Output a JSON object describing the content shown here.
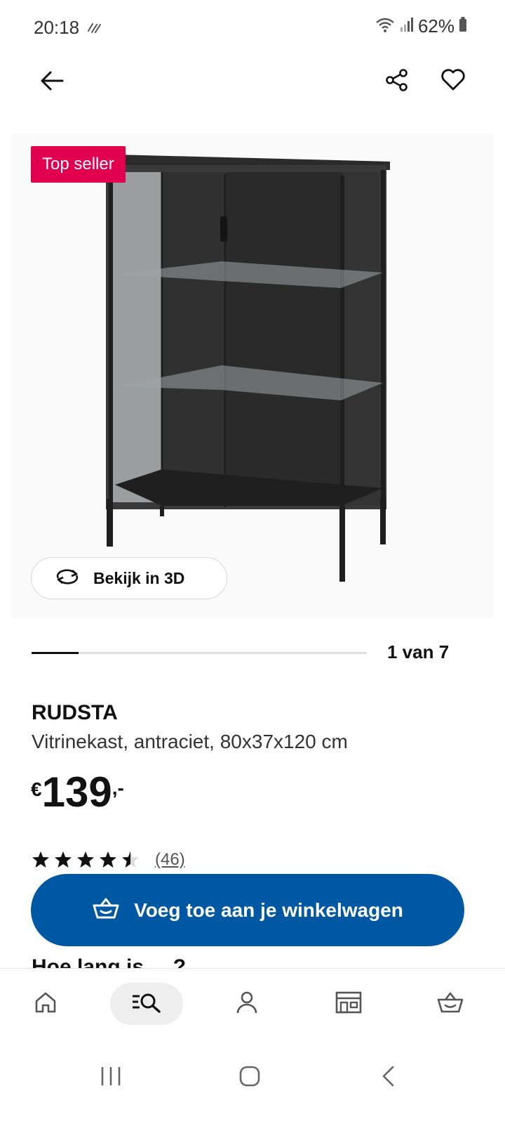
{
  "status_bar": {
    "time": "20:18",
    "battery": "62%"
  },
  "product": {
    "badge": "Top seller",
    "view_3d_label": "Bekijk in 3D",
    "gallery_counter": "1 van 7",
    "gallery_progress": 0.14,
    "brand": "RUDSTA",
    "description": "Vitrinekast, antraciet, 80x37x120 cm",
    "price": {
      "currency": "€",
      "integer": "139",
      "suffix": ",-"
    },
    "rating": {
      "stars": 4.5,
      "count": "(46)"
    }
  },
  "cart_button_label": "Voeg toe aan je winkelwagen",
  "next_heading": "Hoe lang is ... ?",
  "icons": {
    "top_bar": [
      "back-arrow-icon",
      "share-icon",
      "heart-icon"
    ],
    "bottom_nav": [
      "home-icon",
      "search-icon",
      "profile-icon",
      "store-icon",
      "cart-icon"
    ],
    "system_nav": [
      "recents-icon",
      "home-circle-icon",
      "back-chevron-icon"
    ]
  },
  "colors": {
    "badge": "#e0004d",
    "cart_button": "#0058a3",
    "text": "#111111"
  }
}
